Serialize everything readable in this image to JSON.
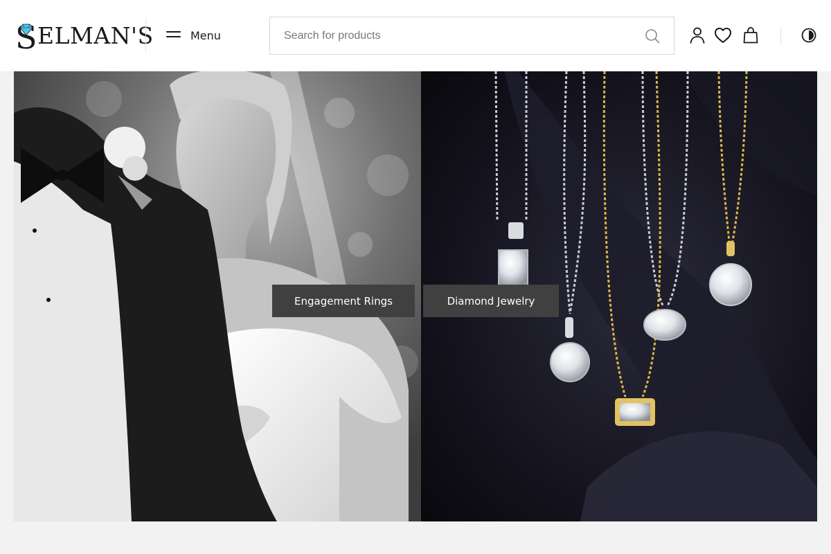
{
  "brand": {
    "name": "ELMAN'S",
    "initial": "S",
    "accent": "#4cc6e6"
  },
  "header": {
    "menu_label": "Menu",
    "search_placeholder": "Search for products",
    "icons": [
      "search-icon",
      "account-icon",
      "wishlist-heart-icon",
      "bag-icon",
      "contrast-toggle-icon"
    ]
  },
  "hero": {
    "left_image": "black-and-white wedding couple photo",
    "right_image": "diamond pendant necklaces on dark satin",
    "cta_engagement": "Engagement Rings",
    "cta_diamond": "Diamond Jewelry",
    "cta_bg": "#404040"
  },
  "colors": {
    "header_bg": "#ffffff",
    "page_bg": "#f2f2f2",
    "text": "#1a1a1a"
  }
}
